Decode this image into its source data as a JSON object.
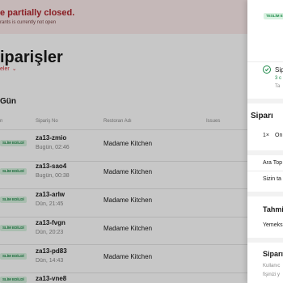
{
  "banner": {
    "title": "e partially closed.",
    "subtitle": "rants is currently not open"
  },
  "page_title": "iparişler",
  "dropdown_label": "eler",
  "section_title": "Gün",
  "table": {
    "headers": [
      "n",
      "Sipariş No",
      "Restoran Adı",
      "Issues"
    ],
    "rows": [
      {
        "status": "SLİM EDİLDİ",
        "order_id": "za13-zmio",
        "time": "Bugün, 02:46",
        "restaurant": "Madame Kitchen"
      },
      {
        "status": "SLİM EDİLDİ",
        "order_id": "za13-sao4",
        "time": "Bugün, 00:38",
        "restaurant": "Madame Kitchen"
      },
      {
        "status": "SLİM EDİLDİ",
        "order_id": "za13-arlw",
        "time": "Dün, 21:45",
        "restaurant": "Madame Kitchen"
      },
      {
        "status": "SLİM EDİLDİ",
        "order_id": "za13-fvgn",
        "time": "Dün, 20:23",
        "restaurant": "Madame Kitchen"
      },
      {
        "status": "SLİM EDİLDİ",
        "order_id": "za13-pd83",
        "time": "Dün, 14:43",
        "restaurant": "Madame Kitchen"
      },
      {
        "status": "SLİM EDİLDİ",
        "order_id": "za13-vne8",
        "time": "",
        "restaurant": ""
      }
    ]
  },
  "drawer": {
    "status_badge": "TESLİM E",
    "step_title": "Siparı",
    "step_sub1": "3 c",
    "step_sub2": "Ta",
    "section1_title": "Siparı",
    "item_qty": "1×",
    "item_name": "On",
    "subtotal_label": "Ara Top",
    "fee_label": "Sizin ta",
    "estimate_title": "Tahmi",
    "estimate_line": "Yemeks",
    "section2_title": "Siparı",
    "note_line1": "Kullanıc",
    "note_line2": "fişinizi y"
  },
  "colors": {
    "accent": "#d0333b",
    "success": "#1f8a4a",
    "success_bg": "#d9f2e1",
    "banner_bg": "#fdecec"
  }
}
